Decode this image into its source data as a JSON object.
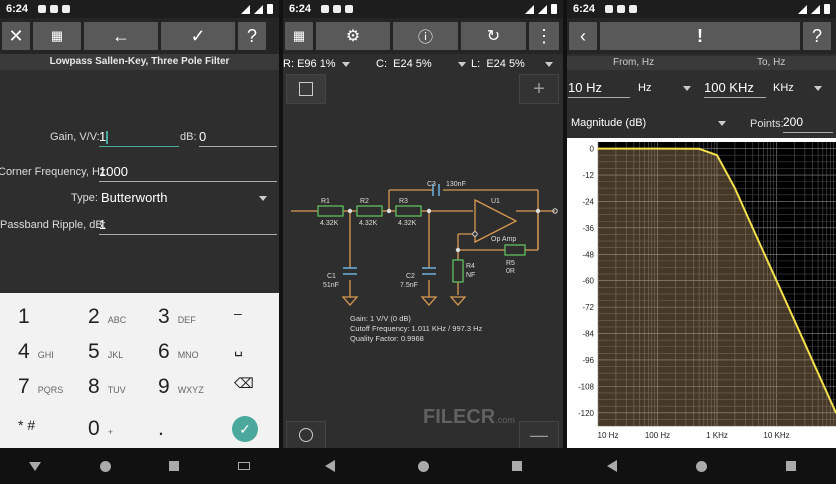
{
  "status": {
    "time": "6:24"
  },
  "screen1": {
    "title": "Lowpass Sallen-Key, Three Pole Filter",
    "gain_label": "Gain, V/V:",
    "gain_value": "1",
    "db_label": "dB:",
    "db_value": "0",
    "corner_label": "Corner Frequency, Hz:",
    "corner_value": "1000",
    "type_label": "Type:",
    "type_value": "Butterworth",
    "ripple_label": "Passband Ripple, dB:",
    "ripple_value": "1",
    "keys": [
      {
        "d": "1",
        "l": ""
      },
      {
        "d": "2",
        "l": "ABC"
      },
      {
        "d": "3",
        "l": "DEF"
      },
      {
        "d": "–",
        "l": ""
      },
      {
        "d": "4",
        "l": "GHI"
      },
      {
        "d": "5",
        "l": "JKL"
      },
      {
        "d": "6",
        "l": "MNO"
      },
      {
        "d": "␣",
        "l": ""
      },
      {
        "d": "7",
        "l": "PQRS"
      },
      {
        "d": "8",
        "l": "TUV"
      },
      {
        "d": "9",
        "l": "WXYZ"
      },
      {
        "d": "⌫",
        "l": ""
      },
      {
        "d": "* #",
        "l": ""
      },
      {
        "d": "0",
        "l": "+"
      },
      {
        "d": ".",
        "l": ""
      },
      {
        "d": "✓",
        "l": ""
      }
    ]
  },
  "screen2": {
    "r_label": "R:",
    "r_value": "E96 1%",
    "c_label": "C:",
    "c_value": "E24 5%",
    "l_label": "L:",
    "l_value": "E24 5%",
    "components": {
      "r1": "R1",
      "r1v": "4.32K",
      "r2": "R2",
      "r2v": "4.32K",
      "r3": "R3",
      "r3v": "4.32K",
      "c1": "C1",
      "c1v": "51nF",
      "c2": "C2",
      "c2v": "7.5nF",
      "c3": "C3",
      "c3v": "130nF",
      "u1": "U1",
      "opamp": "Op Amp",
      "r4": "R4",
      "r4v": "NF",
      "r5": "R5",
      "r5v": "0R"
    },
    "gain_text": "Gain: 1 V/V (0 dB)",
    "cutoff_text": "Cutoff Frequency: 1.011 KHz / 997.3 Hz",
    "quality_text": "Quality Factor: 0.9968",
    "watermark": "FILECR",
    "watermark_sub": ".com"
  },
  "screen3": {
    "exclaim": "!",
    "help": "?",
    "from_label": "From, Hz",
    "to_label": "To, Hz",
    "from_value": "10 Hz",
    "from_unit": "Hz",
    "to_value": "100 KHz",
    "to_unit": "KHz",
    "mode": "Magnitude (dB)",
    "points_label": "Points:",
    "points_value": "200"
  },
  "chart_data": {
    "type": "line",
    "title": "",
    "xlabel": "",
    "ylabel": "",
    "x_scale": "log",
    "x_ticks": [
      "10 Hz",
      "100 Hz",
      "1 KHz",
      "10 KHz"
    ],
    "x": [
      10,
      100,
      500,
      1000,
      2000,
      5000,
      10000,
      20000,
      50000,
      100000
    ],
    "y_ticks": [
      "0",
      "-12",
      "-24",
      "-36",
      "-48",
      "-60",
      "-72",
      "-84",
      "-96",
      "-108",
      "-120"
    ],
    "ylim": [
      -126,
      3
    ],
    "grid": true,
    "line_color": "#f4e04a",
    "series": [
      {
        "values": [
          0,
          0,
          -0.1,
          -3,
          -18,
          -42,
          -60,
          -78,
          -102,
          -120
        ]
      }
    ]
  }
}
